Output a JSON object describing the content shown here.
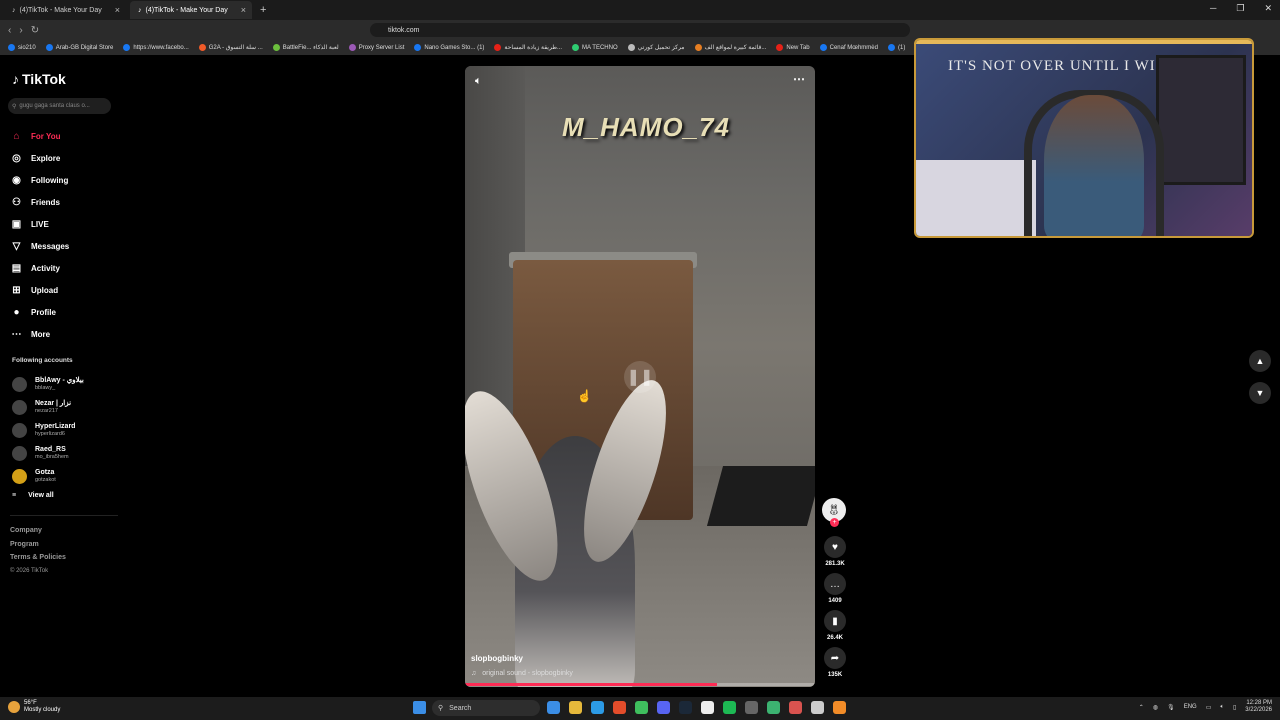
{
  "browser": {
    "tabs": [
      {
        "label": "(4)TikTok - Make Your Day",
        "active": false
      },
      {
        "label": "(4)TikTok - Make Your Day",
        "active": true
      }
    ],
    "url": "tiktok.com",
    "bookmarks": [
      "sio210",
      "Arab-GB Digital Store",
      "https://www.facebo...",
      "G2A - سلة التسوق ...",
      "BattleFie... لعبة الذكاء",
      "Proxy Server List",
      "Nano Games Sto... (1)",
      "طريقة زيادة المساحة...",
      "MA TECHNO",
      "مركز تحميل كورتي",
      "قائمة كبيرة لمواقع الف...",
      "New Tab",
      "Cenaf Mœhmmėd",
      "(1)"
    ]
  },
  "sidebar": {
    "logo": "TikTok",
    "search_placeholder": "gugu gaga santa claus o...",
    "menu": [
      {
        "label": "For You",
        "icon": "home-icon",
        "active": true
      },
      {
        "label": "Explore",
        "icon": "compass-icon",
        "active": false
      },
      {
        "label": "Following",
        "icon": "following-icon",
        "active": false
      },
      {
        "label": "Friends",
        "icon": "friends-icon",
        "active": false
      },
      {
        "label": "LIVE",
        "icon": "live-icon",
        "active": false
      },
      {
        "label": "Messages",
        "icon": "messages-icon",
        "active": false
      },
      {
        "label": "Activity",
        "icon": "activity-icon",
        "active": false
      },
      {
        "label": "Upload",
        "icon": "upload-icon",
        "active": false
      },
      {
        "label": "Profile",
        "icon": "profile-icon",
        "active": false
      },
      {
        "label": "More",
        "icon": "more-icon",
        "active": false
      }
    ],
    "following_title": "Following accounts",
    "accounts": [
      {
        "name": "BblAwy - بيلاوي",
        "handle": "bblawy_"
      },
      {
        "name": "Nezar | نزار",
        "handle": "nezar217"
      },
      {
        "name": "HyperLizard",
        "handle": "hyperlizard6"
      },
      {
        "name": "Raed_RS",
        "handle": "mo_ibra5hem"
      },
      {
        "name": "Gotza",
        "handle": "gotzakot"
      }
    ],
    "view_all": "View all",
    "footer": [
      "Company",
      "Program",
      "Terms & Policies"
    ],
    "copyright": "© 2026 TikTok"
  },
  "video": {
    "watermark": "M_HAMO_74",
    "author": "slopbogbinky",
    "sound": "original sound - slopbogbinky",
    "progress_percent": 72,
    "likes": "281.3K",
    "comments": "1409",
    "saves": "26.4K",
    "shares": "135K"
  },
  "webcam": {
    "poster_text": "IT'S NOT OVER UNTIL I WIN"
  },
  "taskbar": {
    "temperature": "56°F",
    "weather": "Mostly cloudy",
    "search": "Search",
    "lang": "ENG",
    "time": "12:28 PM",
    "date": "3/22/2026"
  },
  "colors": {
    "accent": "#fe2c55",
    "cam_border": "#c89a3a"
  }
}
